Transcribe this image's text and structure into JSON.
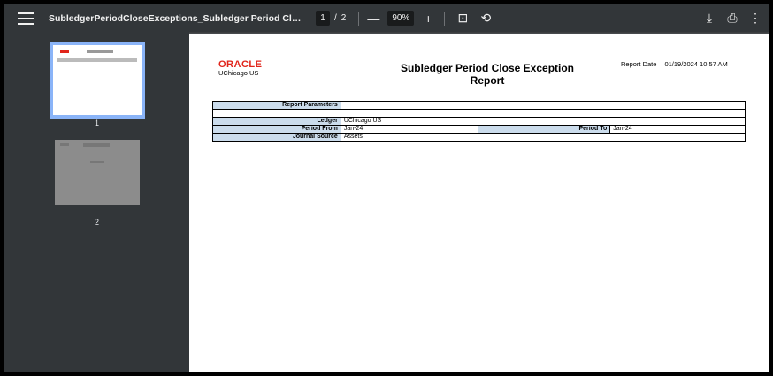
{
  "toolbar": {
    "doc_title": "SubledgerPeriodCloseExceptions_Subledger Period Close Excepti...",
    "current_page": "1",
    "page_separator": "/",
    "total_pages": "2",
    "zoom_value": "90%",
    "zoom_out_glyph": "—",
    "zoom_in_glyph": "+",
    "fit_glyph": "⊡",
    "rotate_glyph": "⟲",
    "download_glyph": "⤓",
    "print_glyph": "⎙",
    "more_glyph": "⋮",
    "icons": [
      "menu-icon",
      "zoom-out-icon",
      "zoom-in-icon",
      "fit-page-icon",
      "rotate-icon",
      "download-icon",
      "print-icon",
      "more-options-icon"
    ]
  },
  "sidebar": {
    "thumbnails": [
      {
        "label": "1",
        "selected": true
      },
      {
        "label": "2",
        "selected": false
      }
    ]
  },
  "report": {
    "logo_text": "ORACLE",
    "logo_sub": "UChicago US",
    "title": "Subledger Period Close Exception Report",
    "date_label": "Report Date",
    "date_value": "01/19/2024 10:57 AM",
    "params_header": "Report Parameters",
    "ledger_label": "Ledger",
    "ledger_value": "UChicago US",
    "period_from_label": "Period From",
    "period_from_value": "Jan-24",
    "period_to_label": "Period To",
    "period_to_value": "Jan-24",
    "journal_source_label": "Journal Source",
    "journal_source_value": "Assets"
  },
  "colors": {
    "toolbar_bg": "#323639",
    "viewer_bg": "#525659",
    "selected_thumb_border": "#8ab4f8",
    "oracle_red": "#e1251b",
    "param_label_bg": "#cbdcec"
  }
}
